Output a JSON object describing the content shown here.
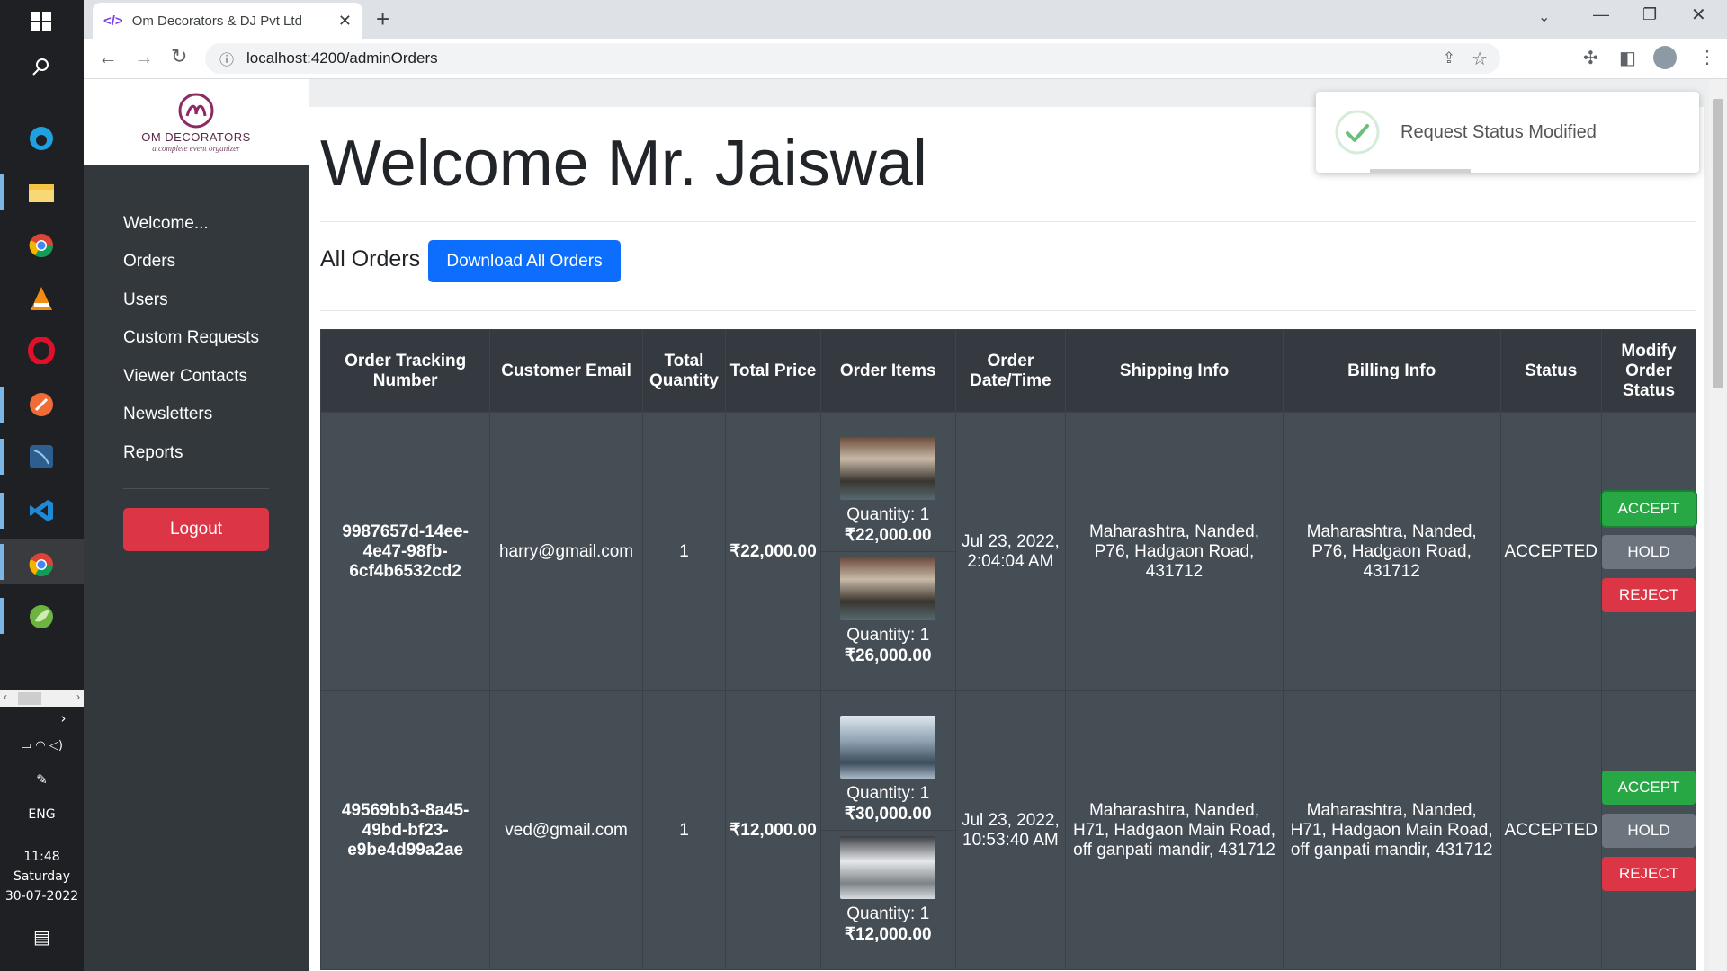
{
  "browser": {
    "tab_title": "Om Decorators & DJ Pvt Ltd",
    "url": "localhost:4200/adminOrders"
  },
  "taskbar": {
    "time": "11:48",
    "day": "Saturday",
    "date": "30-07-2022",
    "lang": "ENG"
  },
  "logo": {
    "name": "OM DECORATORS",
    "tagline": "a complete event organizer"
  },
  "sidebar": {
    "items": [
      {
        "label": "Welcome..."
      },
      {
        "label": "Orders"
      },
      {
        "label": "Users"
      },
      {
        "label": "Custom Requests"
      },
      {
        "label": "Viewer Contacts"
      },
      {
        "label": "Newsletters"
      },
      {
        "label": "Reports"
      }
    ],
    "logout": "Logout"
  },
  "main": {
    "welcome": "Welcome Mr. Jaiswal",
    "section_title": "All Orders",
    "download_btn": "Download All Orders"
  },
  "toast": {
    "message": "Request Status Modified"
  },
  "table": {
    "headers": [
      "Order Tracking Number",
      "Customer Email",
      "Total Quantity",
      "Total Price",
      "Order Items",
      "Order Date/Time",
      "Shipping Info",
      "Billing Info",
      "Status",
      "Modify Order Status"
    ],
    "rows": [
      {
        "tracking": "9987657d-14ee-4e47-98fb-6cf4b6532cd2",
        "email": "harry@gmail.com",
        "quantity": "1",
        "price": "₹22,000.00",
        "items": [
          {
            "qty": "Quantity: 1",
            "price": "₹22,000.00"
          },
          {
            "qty": "Quantity: 1",
            "price": "₹26,000.00"
          }
        ],
        "date": "Jul 23, 2022, 2:04:04 AM",
        "shipping": "Maharashtra, Nanded, P76, Hadgaon Road, 431712",
        "billing": "Maharashtra, Nanded, P76, Hadgaon Road, 431712",
        "status": "ACCEPTED"
      },
      {
        "tracking": "49569bb3-8a45-49bd-bf23-e9be4d99a2ae",
        "email": "ved@gmail.com",
        "quantity": "1",
        "price": "₹12,000.00",
        "items": [
          {
            "qty": "Quantity: 1",
            "price": "₹30,000.00"
          },
          {
            "qty": "Quantity: 1",
            "price": "₹12,000.00"
          }
        ],
        "date": "Jul 23, 2022, 10:53:40 AM",
        "shipping": "Maharashtra, Nanded, H71, Hadgaon Main Road, off ganpati mandir, 431712",
        "billing": "Maharashtra, Nanded, H71, Hadgaon Main Road, off ganpati mandir, 431712",
        "status": "ACCEPTED"
      }
    ],
    "actions": {
      "accept": "ACCEPT",
      "hold": "HOLD",
      "reject": "REJECT"
    }
  },
  "colors": {
    "accent": "#0d6efd",
    "danger": "#dc3545",
    "success": "#28a745",
    "secondary": "#6c757d",
    "sidebar": "#33383d",
    "table": "#454d55"
  }
}
